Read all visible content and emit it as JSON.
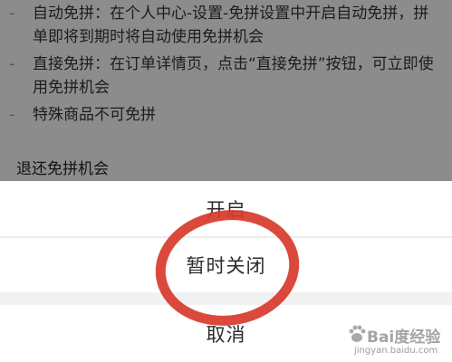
{
  "background_page": {
    "items": [
      {
        "bullet": "-",
        "text": "自动免拼：在个人中心-设置-免拼设置中开启自动免拼，拼单即将到期时将自动使用免拼机会"
      },
      {
        "bullet": "-",
        "text": "直接免拼：在订单详情页，点击“直接免拼”按钮，可立即使用免拼机会"
      },
      {
        "bullet": "-",
        "text": "特殊商品不可免拼"
      }
    ],
    "section_title": "退还免拼机会"
  },
  "action_sheet": {
    "option_open": "开启",
    "option_close_temporarily": "暂时关闭",
    "option_cancel": "取消"
  },
  "watermark": {
    "brand": "Bai度经验",
    "url": "jingyan.baidu.com"
  },
  "colors": {
    "annotation_red": "#d8392b",
    "overlay": "rgba(0,0,0,0.43)"
  }
}
